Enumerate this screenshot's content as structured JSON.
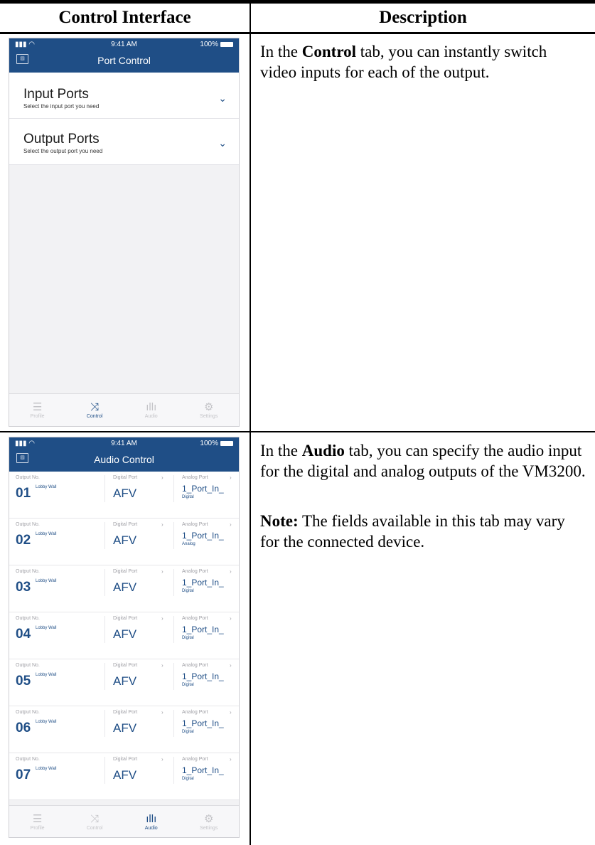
{
  "table": {
    "col1_header": "Control Interface",
    "col2_header": "Description"
  },
  "row1": {
    "desc_pre": "In the ",
    "desc_bold": "Control",
    "desc_post": " tab, you can instantly switch video inputs for each of the output.",
    "phone": {
      "time": "9:41 AM",
      "battery": "100%",
      "title": "Port Control",
      "sections": [
        {
          "title": "Input Ports",
          "subtitle": "Select the input port you need"
        },
        {
          "title": "Output Ports",
          "subtitle": "Select the output port you need"
        }
      ],
      "tabs": [
        {
          "label": "Profile",
          "icon": "list-icon"
        },
        {
          "label": "Control",
          "icon": "shuffle-icon"
        },
        {
          "label": "Audio",
          "icon": "audio-wave-icon"
        },
        {
          "label": "Settings",
          "icon": "gear-icon"
        }
      ],
      "active_tab": "Control"
    }
  },
  "row2": {
    "desc_pre": "In the ",
    "desc_bold": "Audio",
    "desc_post": " tab, you can specify the audio input for the digital and analog outputs of the VM3200.",
    "note_label": "Note:",
    "note_text": " The fields available in this tab may vary for the connected device.",
    "phone": {
      "time": "9:41 AM",
      "battery": "100%",
      "title": "Audio Control",
      "col_labels": {
        "output": "Output No.",
        "digital": "Digital Port",
        "analog": "Analog Port"
      },
      "rows": [
        {
          "num": "01",
          "name": "Lobby Wall",
          "digital": "AFV",
          "analog": "1_Port_In_",
          "analog_sub": "Digital"
        },
        {
          "num": "02",
          "name": "Lobby Wall",
          "digital": "AFV",
          "analog": "1_Port_In_",
          "analog_sub": "Analog"
        },
        {
          "num": "03",
          "name": "Lobby Wall",
          "digital": "AFV",
          "analog": "1_Port_In_",
          "analog_sub": "Digital"
        },
        {
          "num": "04",
          "name": "Lobby Wall",
          "digital": "AFV",
          "analog": "1_Port_In_",
          "analog_sub": "Digital"
        },
        {
          "num": "05",
          "name": "Lobby Wall",
          "digital": "AFV",
          "analog": "1_Port_In_",
          "analog_sub": "Digital"
        },
        {
          "num": "06",
          "name": "Lobby Wall",
          "digital": "AFV",
          "analog": "1_Port_In_",
          "analog_sub": "Digital"
        },
        {
          "num": "07",
          "name": "Lobby Wall",
          "digital": "AFV",
          "analog": "1_Port_In_",
          "analog_sub": "Digital"
        }
      ],
      "tabs": [
        {
          "label": "Profile",
          "icon": "list-icon"
        },
        {
          "label": "Control",
          "icon": "shuffle-icon"
        },
        {
          "label": "Audio",
          "icon": "audio-wave-icon"
        },
        {
          "label": "Settings",
          "icon": "gear-icon"
        }
      ],
      "active_tab": "Audio"
    }
  },
  "colors": {
    "brand": "#1f4e86"
  }
}
